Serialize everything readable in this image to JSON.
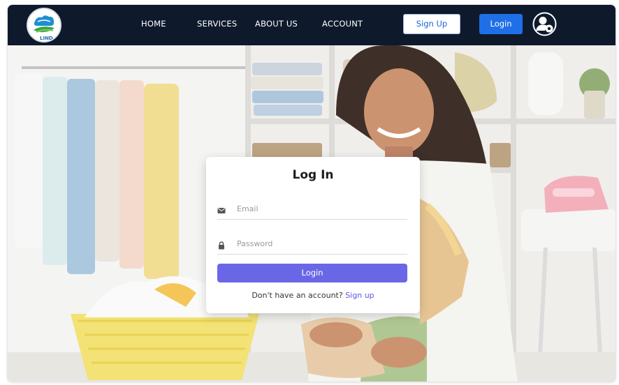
{
  "nav": {
    "links": [
      "HOME",
      "SERVICES",
      "ABOUT US",
      "ACCOUNT"
    ],
    "signup_label": "Sign Up",
    "login_label": "Login",
    "logo_text": "LIND"
  },
  "login_card": {
    "title": "Log In",
    "email_placeholder": "Email",
    "password_placeholder": "Password",
    "submit_label": "Login",
    "signup_prompt": "Don't have an account?",
    "signup_link": "Sign up"
  },
  "icons": {
    "email": "envelope-icon",
    "password": "lock-icon",
    "user": "user-settings-icon"
  },
  "colors": {
    "navbar_bg": "#0e1a2c",
    "signup_text": "#1a63d6",
    "login_button": "#1f6fe8",
    "card_button": "#6a67e6",
    "link": "#5a57e0"
  }
}
